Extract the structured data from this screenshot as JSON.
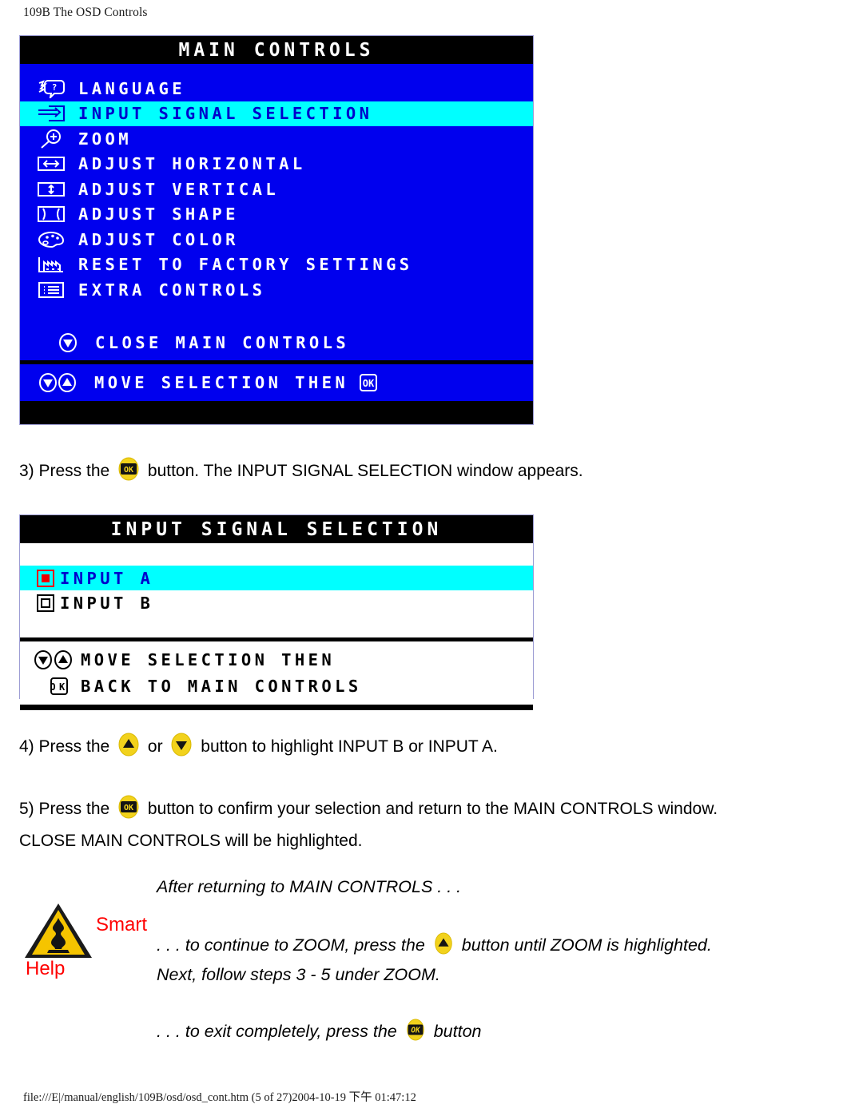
{
  "document": {
    "header": "109B The OSD Controls",
    "footer": "file:///E|/manual/english/109B/osd/osd_cont.htm (5 of 27)2004-10-19 下午 01:47:12"
  },
  "colors": {
    "osd_blue": "#0000ee",
    "osd_highlight_cyan": "#00ffff",
    "osd_black": "#000000",
    "osd_white": "#ffffff",
    "button_yellow": "#f2d21c",
    "smart_help_red": "#ff0000",
    "radio_red": "#ee0000"
  },
  "osd_main": {
    "title": "MAIN CONTROLS",
    "items": [
      {
        "icon": "speech-bubble-question-icon",
        "label": "LANGUAGE",
        "selected": false
      },
      {
        "icon": "arrow-into-box-icon",
        "label": "INPUT SIGNAL SELECTION",
        "selected": true
      },
      {
        "icon": "magnifier-plus-icon",
        "label": "ZOOM",
        "selected": false
      },
      {
        "icon": "horizontal-arrow-box-icon",
        "label": "ADJUST HORIZONTAL",
        "selected": false
      },
      {
        "icon": "vertical-arrow-box-icon",
        "label": "ADJUST VERTICAL",
        "selected": false
      },
      {
        "icon": "pincushion-shape-icon",
        "label": "ADJUST SHAPE",
        "selected": false
      },
      {
        "icon": "color-palette-icon",
        "label": "ADJUST COLOR",
        "selected": false
      },
      {
        "icon": "factory-icon",
        "label": "RESET TO FACTORY SETTINGS",
        "selected": false
      },
      {
        "icon": "list-box-icon",
        "label": "EXTRA CONTROLS",
        "selected": false
      }
    ],
    "close_item": {
      "icon": "down-arrow-circle-icon",
      "label": "CLOSE MAIN CONTROLS"
    },
    "hint": {
      "icons": [
        "down-arrow-circle-icon",
        "up-arrow-circle-icon"
      ],
      "label": "MOVE SELECTION THEN",
      "trailing_icon": "ok-button-icon"
    }
  },
  "osd_input": {
    "title": "INPUT SIGNAL SELECTION",
    "options": [
      {
        "icon": "radio-selected-icon",
        "label": "INPUT A",
        "selected": true
      },
      {
        "icon": "radio-unselected-icon",
        "label": "INPUT B",
        "selected": false
      }
    ],
    "hint_line1": {
      "icons": [
        "down-arrow-circle-icon",
        "up-arrow-circle-icon"
      ],
      "label": "MOVE SELECTION THEN"
    },
    "hint_line2": {
      "icon": "ok-button-icon",
      "label": "BACK TO MAIN CONTROLS"
    }
  },
  "steps": {
    "step3": {
      "before": "3) Press the",
      "button": "ok-button-icon",
      "after": "button. The INPUT SIGNAL SELECTION window appears."
    },
    "step4": {
      "before": "4) Press the",
      "button_up": "up-arrow-button-icon",
      "middle": "or",
      "button_down": "down-arrow-button-icon",
      "after": "button to highlight INPUT B or INPUT A."
    },
    "step5": {
      "before": "5) Press the",
      "button": "ok-button-icon",
      "after": "button to confirm your selection and return to the MAIN CONTROLS window.",
      "line2": "CLOSE MAIN CONTROLS will be highlighted."
    }
  },
  "smart_help": {
    "icon": "warning-triangle-icon",
    "word_smart": "Smart",
    "word_help": "Help",
    "line1": "After returning to MAIN CONTROLS . . .",
    "line2_before": ". . . to continue to ZOOM, press the",
    "line2_button": "up-arrow-button-icon",
    "line2_after": "button until ZOOM is highlighted.",
    "line3": "Next, follow steps 3 - 5 under ZOOM.",
    "line4_before": ". . . to exit completely, press the",
    "line4_button": "ok-button-icon",
    "line4_after": "button"
  }
}
